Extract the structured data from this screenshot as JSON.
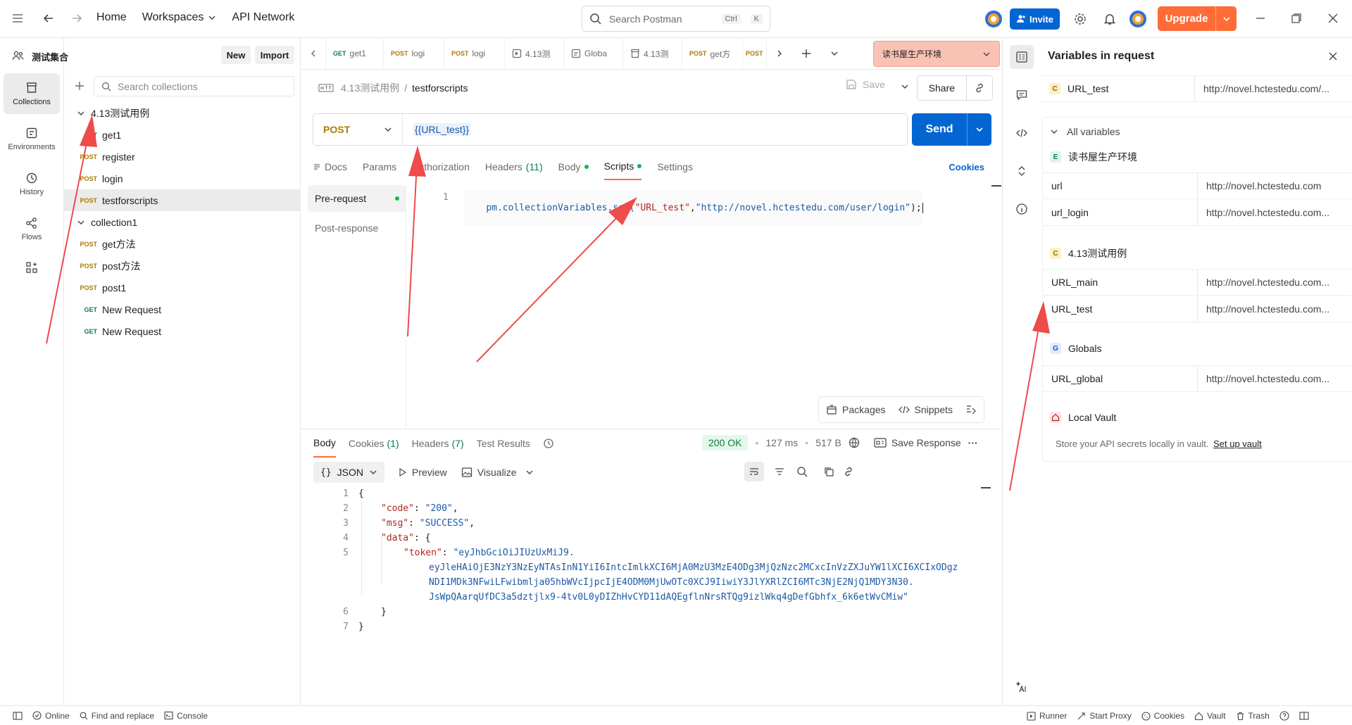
{
  "topbar": {
    "home": "Home",
    "workspaces": "Workspaces",
    "api_network": "API Network",
    "search_placeholder": "Search Postman",
    "shortcut_ctrl": "Ctrl",
    "shortcut_k": "K",
    "invite": "Invite",
    "upgrade": "Upgrade"
  },
  "rail": {
    "collections": "Collections",
    "environments": "Environments",
    "history": "History",
    "flows": "Flows"
  },
  "sidebar": {
    "workspace_name": "测试集合",
    "new": "New",
    "import": "Import",
    "search_placeholder": "Search collections",
    "folder1": "4.13测试用例",
    "folder2": "collection1",
    "items": [
      {
        "method": "GET",
        "name": "get1"
      },
      {
        "method": "POST",
        "name": "register"
      },
      {
        "method": "POST",
        "name": "login"
      },
      {
        "method": "POST",
        "name": "testforscripts"
      },
      {
        "method": "POST",
        "name": "get方法"
      },
      {
        "method": "POST",
        "name": "post方法"
      },
      {
        "method": "POST",
        "name": "post1"
      },
      {
        "method": "GET",
        "name": "New Request"
      },
      {
        "method": "GET",
        "name": "New Request"
      }
    ]
  },
  "tabs": [
    {
      "method": "GET",
      "label": "get1"
    },
    {
      "method": "POST",
      "label": "logi"
    },
    {
      "method": "POST",
      "label": "logi"
    },
    {
      "method": "",
      "label": "4.13测"
    },
    {
      "method": "",
      "label": "Globa"
    },
    {
      "method": "",
      "label": "4.13测"
    },
    {
      "method": "POST",
      "label": "get方"
    },
    {
      "method": "POST",
      "label": ""
    }
  ],
  "environment": "读书屋生产环境",
  "breadcrumb": {
    "parent": "4.13测试用例",
    "sep": "/",
    "current": "testforscripts",
    "save": "Save",
    "share": "Share"
  },
  "request": {
    "method": "POST",
    "url": "{{URL_test}}",
    "send": "Send",
    "tabs": {
      "docs": "Docs",
      "params": "Params",
      "authorization": "Authorization",
      "headers": "Headers",
      "headers_count": "(11)",
      "body": "Body",
      "scripts": "Scripts",
      "settings": "Settings",
      "cookies": "Cookies"
    }
  },
  "scripts": {
    "pre_request": "Pre-request",
    "post_response": "Post-response",
    "line_no": "1",
    "code_prefix": "pm.collectionVariables.set(",
    "code_arg1": "\"URL_test\"",
    "code_comma": ",",
    "code_arg2": "\"http://novel.hctestedu.com/user/login\"",
    "code_suffix": ");",
    "packages": "Packages",
    "snippets": "Snippets"
  },
  "response": {
    "tabs": {
      "body": "Body",
      "cookies": "Cookies",
      "cookies_count": "(1)",
      "headers": "Headers",
      "headers_count": "(7)",
      "test_results": "Test Results"
    },
    "status": "200 OK",
    "time": "127 ms",
    "size": "517 B",
    "save_response": "Save Response",
    "format": "JSON",
    "preview": "Preview",
    "visualize": "Visualize",
    "lines": {
      "n1": "1",
      "n2": "2",
      "n3": "3",
      "n4": "4",
      "n5": "5",
      "n6": "6",
      "n7": "7",
      "open_brace": "{",
      "code_key": "\"code\"",
      "code_val": "\"200\"",
      "msg_key": "\"msg\"",
      "msg_val": "\"SUCCESS\"",
      "data_key": "\"data\"",
      "token_key": "\"token\"",
      "token_1": "\"eyJhbGciOiJIUzUxMiJ9.",
      "token_2": "eyJleHAiOjE3NzY3NzEyNTAsInN1YiI6IntcImlkXCI6MjA0MzU3MzE4ODg3MjQzNzc2MCxcInVzZXJuYW1lXCI6XCIxODgz",
      "token_3": "NDI1MDk3NFwiLFwibmlja05hbWVcIjpcIjE4ODM0MjUwOTc0XCJ9IiwiY3JlYXRlZCI6MTc3NjE2NjQ1MDY3N30.",
      "token_4": "JsWpQAarqUfDC3a5dztjlx9-4tv0L0yDIZhHvCYD11dAQEgflnNrsRTQg9izlWkq4gDefGbhfx_6k6etWvCMiw\"",
      "close_inner": "}",
      "close_outer": "}"
    }
  },
  "variables": {
    "title": "Variables in request",
    "top_key": "URL_test",
    "top_val": "http://novel.hctestedu.com/...",
    "all_variables": "All variables",
    "env_name": "读书屋生产环境",
    "env_vars": [
      {
        "key": "url",
        "value": "http://novel.hctestedu.com"
      },
      {
        "key": "url_login",
        "value": "http://novel.hctestedu.com..."
      }
    ],
    "coll_name": "4.13测试用例",
    "coll_vars": [
      {
        "key": "URL_main",
        "value": "http://novel.hctestedu.com..."
      },
      {
        "key": "URL_test",
        "value": "http://novel.hctestedu.com..."
      }
    ],
    "globals_name": "Globals",
    "global_vars": [
      {
        "key": "URL_global",
        "value": "http://novel.hctestedu.com..."
      }
    ],
    "vault_name": "Local Vault",
    "vault_text": "Store your API secrets locally in vault.",
    "vault_link": "Set up vault"
  },
  "statusbar": {
    "online": "Online",
    "find_replace": "Find and replace",
    "console": "Console",
    "runner": "Runner",
    "start_proxy": "Start Proxy",
    "cookies": "Cookies",
    "vault": "Vault",
    "trash": "Trash"
  },
  "colors": {
    "accent": "#ff6c37",
    "primary": "#0265d2",
    "annotation_arrow": "#ee4b4b"
  }
}
